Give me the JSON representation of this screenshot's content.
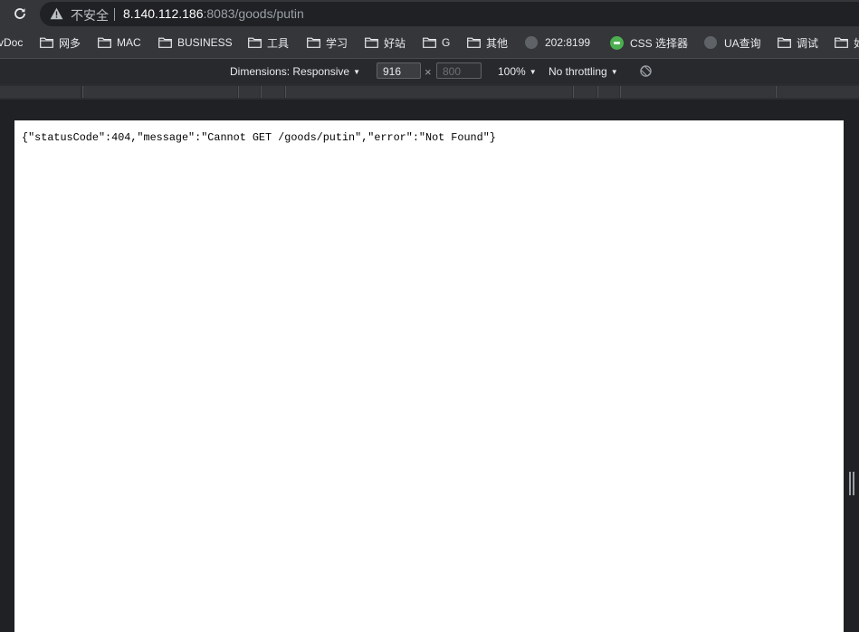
{
  "address_bar": {
    "security_label": "不安全",
    "host": "8.140.112.186",
    "path": ":8083/goods/putin"
  },
  "bookmarks": [
    {
      "label": "vDoc",
      "icon": "none"
    },
    {
      "label": "网多",
      "icon": "folder-icon"
    },
    {
      "label": "MAC",
      "icon": "folder-icon"
    },
    {
      "label": "BUSINESS",
      "icon": "folder-icon"
    },
    {
      "label": "工具",
      "icon": "folder-icon"
    },
    {
      "label": "学习",
      "icon": "folder-icon"
    },
    {
      "label": "好站",
      "icon": "folder-icon"
    },
    {
      "label": "G",
      "icon": "folder-icon"
    },
    {
      "label": "其他",
      "icon": "folder-icon"
    },
    {
      "label": "202:8199",
      "icon": "globe-icon"
    },
    {
      "label": "CSS 选择器",
      "icon": "css-selector-icon"
    },
    {
      "label": "UA查询",
      "icon": "globe-icon"
    },
    {
      "label": "调试",
      "icon": "folder-icon"
    },
    {
      "label": "如",
      "icon": "folder-icon"
    }
  ],
  "device_toolbar": {
    "dimensions_label": "Dimensions: Responsive",
    "width_value": "916",
    "height_placeholder": "800",
    "times": "×",
    "zoom": "100%",
    "throttling": "No throttling"
  },
  "page": {
    "body_text": "{\"statusCode\":404,\"message\":\"Cannot GET /goods/putin\",\"error\":\"Not Found\"}"
  }
}
